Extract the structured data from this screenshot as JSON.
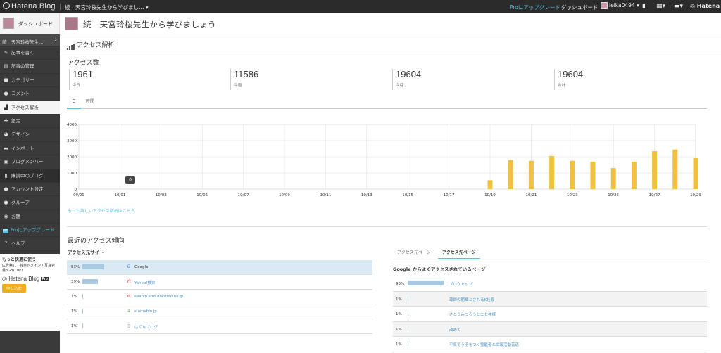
{
  "topbar": {
    "logo": "Hatena Blog",
    "blog_name": "続　天宮玲桜先生から学びまし…",
    "pro_link": "Proにアップグレード",
    "dashboard": "ダッシュボード",
    "user": "leika0494",
    "hatena": "Hatena"
  },
  "header": {
    "dashboard_label": "ダッシュボード",
    "blog_title": "続　天宮玲桜先生から学びましょう"
  },
  "sidebar": {
    "blog_label": "続　天宮玲桜先生…",
    "items": [
      {
        "label": "記事を書く",
        "icon": "edit-icon"
      },
      {
        "label": "記事の管理",
        "icon": "document-icon"
      },
      {
        "label": "カテゴリー",
        "icon": "folder-icon"
      },
      {
        "label": "コメント",
        "icon": "comment-icon"
      },
      {
        "label": "アクセス解析",
        "icon": "chart-icon"
      },
      {
        "label": "設定",
        "icon": "wrench-icon"
      },
      {
        "label": "デザイン",
        "icon": "palette-icon"
      },
      {
        "label": "インポート",
        "icon": "truck-icon"
      },
      {
        "label": "ブログメンバー",
        "icon": "members-icon"
      },
      {
        "label": "購読中のブログ",
        "icon": "book-icon"
      },
      {
        "label": "アカウント設定",
        "icon": "gear-icon"
      },
      {
        "label": "グループ",
        "icon": "group-icon"
      },
      {
        "label": "お題",
        "icon": "theme-icon"
      },
      {
        "label": "Proにアップグレード",
        "icon": "pro-icon"
      },
      {
        "label": "ヘルプ",
        "icon": "help-icon"
      }
    ],
    "promo": {
      "title": "もっと快適に使う",
      "text": "広告無し・独自ドメイン・写真容量3GBにUP！",
      "logo": "Hatena Blog",
      "logo_badge": "Pro",
      "button": "申し込む"
    }
  },
  "main": {
    "section_title": "アクセス解析",
    "access_count_title": "アクセス数",
    "stats": [
      {
        "value": "1961",
        "label": "今日"
      },
      {
        "value": "11586",
        "label": "今週"
      },
      {
        "value": "19604",
        "label": "今月"
      },
      {
        "value": "19604",
        "label": "合計"
      }
    ],
    "tabs": [
      "日",
      "時間"
    ],
    "more_link": "もっと詳しいアクセス解析はこちら",
    "trend_title": "最近のアクセス傾向",
    "sources_title": "アクセス元サイト",
    "sources": [
      {
        "pct": "53%",
        "share": 0.53,
        "name": "Google",
        "icon": "google-icon"
      },
      {
        "pct": "39%",
        "share": 0.39,
        "name": "Yahoo!検索",
        "icon": "yahoo-icon"
      },
      {
        "pct": "1%",
        "share": 0.01,
        "name": "search.smt.docomo.ne.jp",
        "icon": "docomo-icon"
      },
      {
        "pct": "1%",
        "share": 0.01,
        "name": "s.ameblo.jp",
        "icon": "ameblo-icon"
      },
      {
        "pct": "1%",
        "share": 0.01,
        "name": "はてなブログ",
        "icon": "page-icon"
      }
    ],
    "right_tabs": [
      "アクセス元ページ",
      "アクセス先ページ"
    ],
    "dest_title": "Google からよくアクセスされているページ",
    "destinations": [
      {
        "pct": "93%",
        "share": 0.93,
        "name": "ブログトップ"
      },
      {
        "pct": "1%",
        "share": 0.01,
        "name": "尊師の範疇とされるK社長"
      },
      {
        "pct": "1%",
        "share": 0.01,
        "name": "さとうみつろうとエセ神様"
      },
      {
        "pct": "1%",
        "share": 0.01,
        "name": "改めて"
      },
      {
        "pct": "1%",
        "share": 0.01,
        "name": "平気でうそをつく霊能者と広報活動芸道"
      }
    ]
  },
  "colors": {
    "bar": "#f0c040",
    "accent": "#5bc0de",
    "sidebar": "#3a3a3a"
  },
  "chart_data": {
    "type": "bar",
    "x": [
      "09/29",
      "09/30",
      "10/01",
      "10/02",
      "10/03",
      "10/04",
      "10/05",
      "10/06",
      "10/07",
      "10/08",
      "10/09",
      "10/10",
      "10/11",
      "10/12",
      "10/13",
      "10/14",
      "10/15",
      "10/16",
      "10/17",
      "10/18",
      "10/19",
      "10/20",
      "10/21",
      "10/22",
      "10/23",
      "10/24",
      "10/25",
      "10/26",
      "10/27",
      "10/28",
      "10/29"
    ],
    "values": [
      0,
      0,
      0,
      0,
      0,
      0,
      0,
      0,
      0,
      0,
      0,
      0,
      0,
      0,
      0,
      0,
      0,
      0,
      0,
      0,
      550,
      1800,
      1750,
      2050,
      1750,
      1700,
      1300,
      1700,
      2350,
      2450,
      1950
    ],
    "tick_labels": [
      "09/29",
      "10/01",
      "10/03",
      "10/05",
      "10/07",
      "10/09",
      "10/11",
      "10/13",
      "10/15",
      "10/17",
      "10/19",
      "10/21",
      "10/23",
      "10/25",
      "10/27",
      "10/29"
    ],
    "yticks": [
      "0",
      "1000",
      "2000",
      "3000",
      "4000"
    ],
    "ylim": [
      0,
      4000
    ],
    "tooltip": "0",
    "grid": true
  }
}
